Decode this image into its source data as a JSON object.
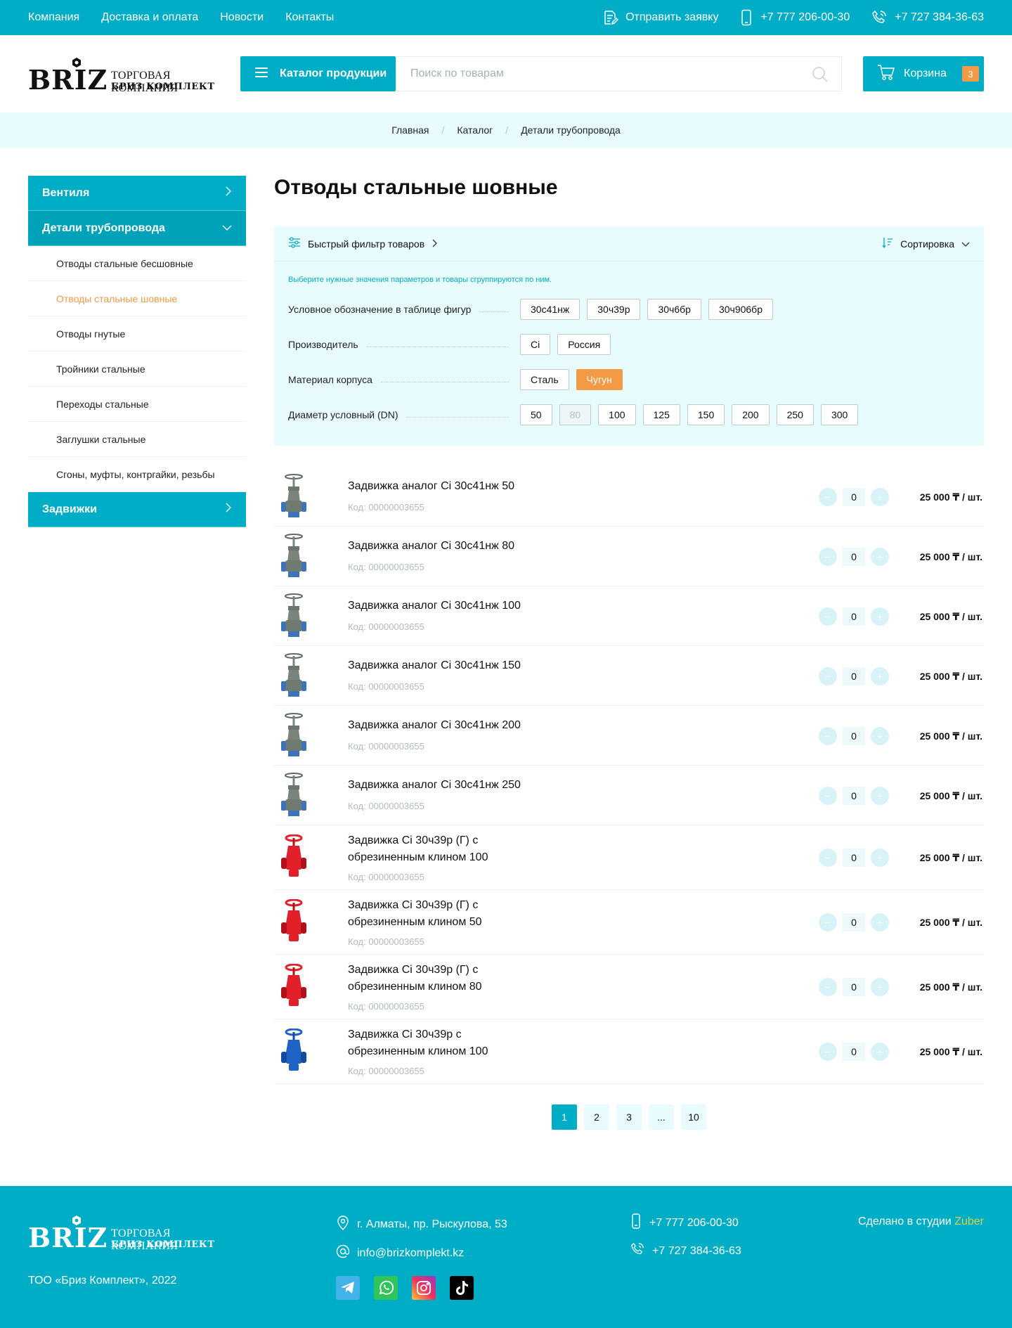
{
  "topbar": {
    "nav": [
      "Компания",
      "Доставка и оплата",
      "Новости",
      "Контакты"
    ],
    "request": "Отправить заявку",
    "phone1": "+7 777 206-00-30",
    "phone2": "+7 727 384-36-63"
  },
  "logo": {
    "brand": "BRIZ",
    "line1": "ТОРГОВАЯ КОМПАНИЯ",
    "line2": "БРИЗ КОМПЛЕКТ"
  },
  "header": {
    "catalog_label": "Каталог продукции",
    "search_placeholder": "Поиск по товарам",
    "cart_label": "Корзина",
    "cart_count": "3"
  },
  "breadcrumb": [
    "Главная",
    "Каталог",
    "Детали трубопровода"
  ],
  "sidebar": {
    "section1": "Вентиля",
    "section2": "Детали трубопровода",
    "items": [
      "Отводы стальные бесшовные",
      "Отводы стальные шовные",
      "Отводы гнутые",
      "Тройники стальные",
      "Переходы стальные",
      "Заглушки стальные",
      "Сгоны, муфты, контргайки, резьбы"
    ],
    "active_index": 1,
    "section3": "Задвижки"
  },
  "page_title": "Отводы стальные шовные",
  "filter": {
    "quick": "Быстрый фильтр товаров",
    "sort": "Сортировка",
    "hint": "Выберите нужные значения параметров и товары сгруппируются по ним.",
    "rows": [
      {
        "label": "Условное обозначение в таблице фигур",
        "chips": [
          "30с41нж",
          "30ч39р",
          "30ч6бр",
          "30ч906бр"
        ]
      },
      {
        "label": "Производитель",
        "chips": [
          "Ci",
          "Россия"
        ]
      },
      {
        "label": "Материал корпуса",
        "chips": [
          "Сталь",
          "Чугун"
        ]
      },
      {
        "label": "Диаметр условный (DN)",
        "chips": [
          "50",
          "80",
          "100",
          "125",
          "150",
          "200",
          "250",
          "300"
        ]
      }
    ],
    "selected": "Чугун",
    "disabled": "80"
  },
  "products": [
    {
      "name": "Задвижка аналог Ci 30с41нж 50",
      "code": "Код: 00000003655",
      "qty": "0",
      "price": "25 000 ₸ / шт.",
      "kind": "gray"
    },
    {
      "name": "Задвижка аналог Ci 30с41нж 80",
      "code": "Код: 00000003655",
      "qty": "0",
      "price": "25 000 ₸ / шт.",
      "kind": "gray"
    },
    {
      "name": "Задвижка аналог Ci 30с41нж 100",
      "code": "Код: 00000003655",
      "qty": "0",
      "price": "25 000 ₸ / шт.",
      "kind": "gray"
    },
    {
      "name": "Задвижка аналог Ci 30с41нж 150",
      "code": "Код: 00000003655",
      "qty": "0",
      "price": "25 000 ₸ / шт.",
      "kind": "gray"
    },
    {
      "name": "Задвижка аналог Ci 30с41нж 200",
      "code": "Код: 00000003655",
      "qty": "0",
      "price": "25 000 ₸ / шт.",
      "kind": "gray"
    },
    {
      "name": "Задвижка аналог Ci 30с41нж 250",
      "code": "Код: 00000003655",
      "qty": "0",
      "price": "25 000 ₸ / шт.",
      "kind": "gray"
    },
    {
      "name": "Задвижка Ci 30ч39р (Г) с обрезиненным клином 100",
      "code": "Код: 00000003655",
      "qty": "0",
      "price": "25 000 ₸ / шт.",
      "kind": "red"
    },
    {
      "name": "Задвижка Ci 30ч39р (Г) с обрезиненным клином 50",
      "code": "Код: 00000003655",
      "qty": "0",
      "price": "25 000 ₸ / шт.",
      "kind": "red"
    },
    {
      "name": "Задвижка Ci 30ч39р (Г) с обрезиненным клином 80",
      "code": "Код: 00000003655",
      "qty": "0",
      "price": "25 000 ₸ / шт.",
      "kind": "red"
    },
    {
      "name": "Задвижка Ci 30ч39р с обрезиненным клином 100",
      "code": "Код: 00000003655",
      "qty": "0",
      "price": "25 000 ₸ / шт.",
      "kind": "blue"
    }
  ],
  "pagination": [
    "1",
    "2",
    "3",
    "...",
    "10"
  ],
  "footer": {
    "address": "г. Алматы, пр. Рыскулова, 53",
    "email": "info@brizkomplekt.kz",
    "copyright": "ТОО «Бриз Комплект», 2022",
    "phone1": "+7 777 206-00-30",
    "phone2": "+7 727 384-36-63",
    "studio": "Сделано в студии",
    "studio_name": "Zuber"
  },
  "colors": {
    "accent": "#00adc6",
    "orange": "#f29a45",
    "light": "#e8fbfd"
  }
}
